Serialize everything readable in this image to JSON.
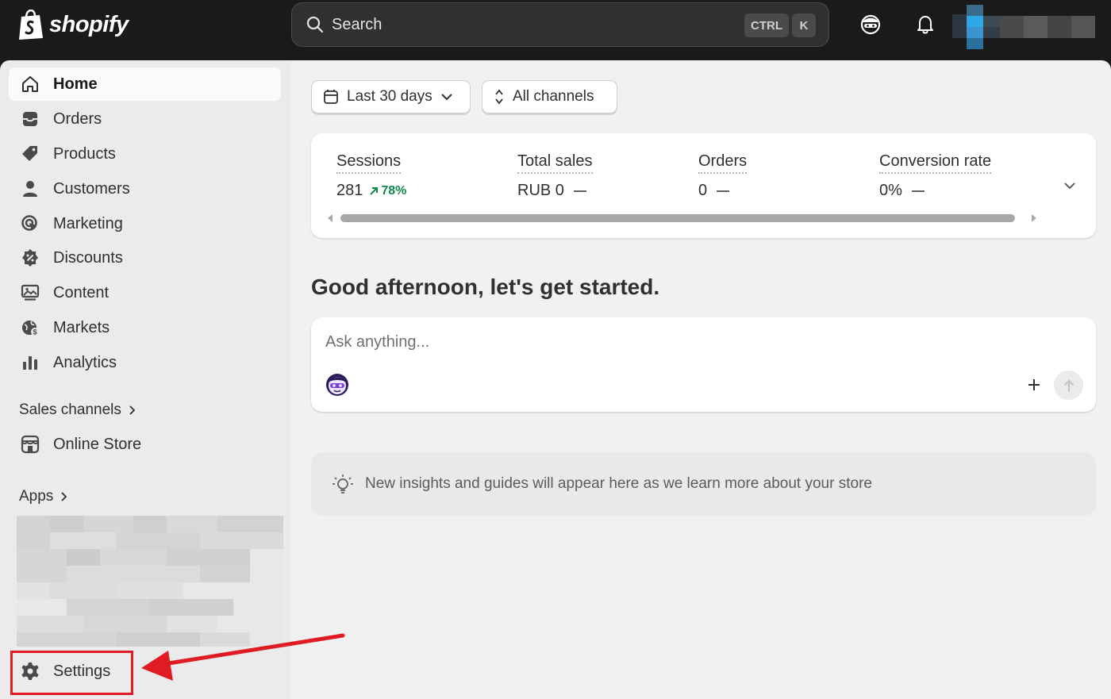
{
  "brand": {
    "name": "shopify"
  },
  "search": {
    "label": "Search",
    "shortcut_ctrl": "CTRL",
    "shortcut_key": "K"
  },
  "sidebar": {
    "items": [
      {
        "label": "Home",
        "icon": "home-icon",
        "active": true
      },
      {
        "label": "Orders",
        "icon": "inbox-icon"
      },
      {
        "label": "Products",
        "icon": "tag-icon"
      },
      {
        "label": "Customers",
        "icon": "person-icon"
      },
      {
        "label": "Marketing",
        "icon": "target-icon"
      },
      {
        "label": "Discounts",
        "icon": "discount-icon"
      },
      {
        "label": "Content",
        "icon": "image-icon"
      },
      {
        "label": "Markets",
        "icon": "globe-icon"
      },
      {
        "label": "Analytics",
        "icon": "bar-chart-icon"
      }
    ],
    "sales_channels": {
      "label": "Sales channels",
      "items": [
        {
          "label": "Online Store",
          "icon": "store-icon"
        }
      ]
    },
    "apps": {
      "label": "Apps"
    },
    "settings": {
      "label": "Settings",
      "icon": "gear-icon"
    }
  },
  "filters": {
    "date_range": "Last 30 days",
    "channels": "All channels"
  },
  "metrics": [
    {
      "title": "Sessions",
      "value": "281",
      "trend": "78%"
    },
    {
      "title": "Total sales",
      "value": "RUB 0"
    },
    {
      "title": "Orders",
      "value": "0"
    },
    {
      "title": "Conversion rate",
      "value": "0%"
    }
  ],
  "greeting": "Good afternoon, let's get started.",
  "ask": {
    "placeholder": "Ask anything..."
  },
  "insights": {
    "text": "New insights and guides will appear here as we learn more about your store"
  },
  "colors": {
    "accent_green": "#0f8a4b",
    "highlight_red": "#e01b24",
    "topbar": "#1a1a1a"
  }
}
